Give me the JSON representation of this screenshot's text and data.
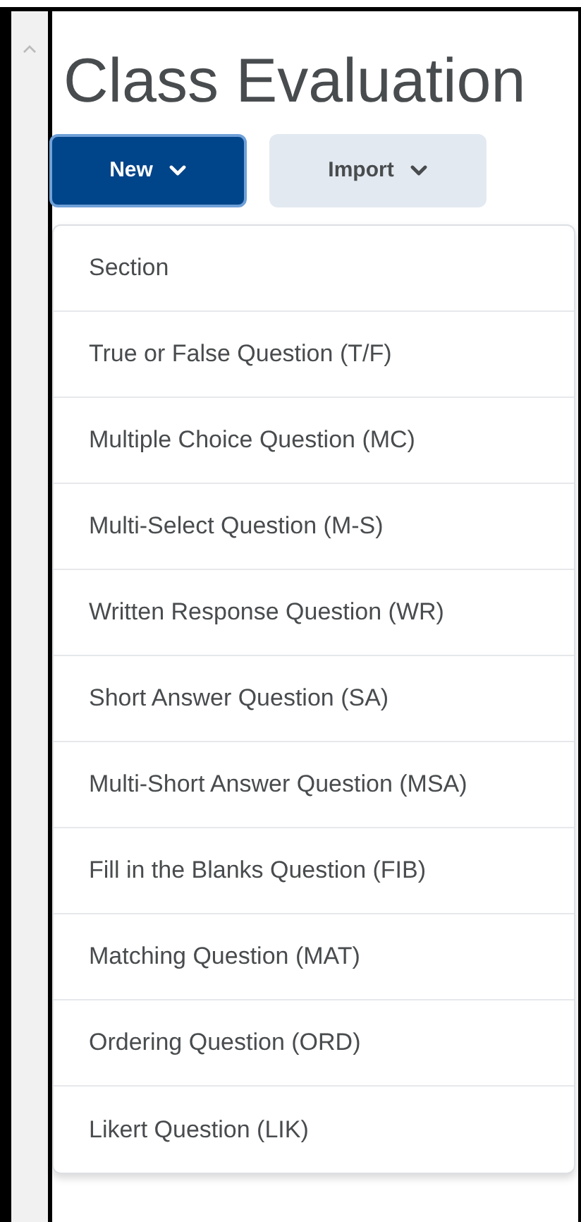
{
  "page_title": "Class Evaluation",
  "buttons": [
    {
      "label": "New",
      "kind": "primary"
    },
    {
      "label": "Import",
      "kind": "secondary"
    }
  ],
  "menu": {
    "items": [
      {
        "label": "Section"
      },
      {
        "label": "True or False Question (T/F)"
      },
      {
        "label": "Multiple Choice Question (MC)"
      },
      {
        "label": "Multi-Select Question (M-S)"
      },
      {
        "label": "Written Response Question (WR)"
      },
      {
        "label": "Short Answer Question (SA)"
      },
      {
        "label": "Multi-Short Answer Question (MSA)"
      },
      {
        "label": "Fill in the Blanks Question (FIB)"
      },
      {
        "label": "Matching Question (MAT)"
      },
      {
        "label": "Ordering Question (ORD)"
      },
      {
        "label": "Likert Question (LIK)"
      }
    ]
  }
}
